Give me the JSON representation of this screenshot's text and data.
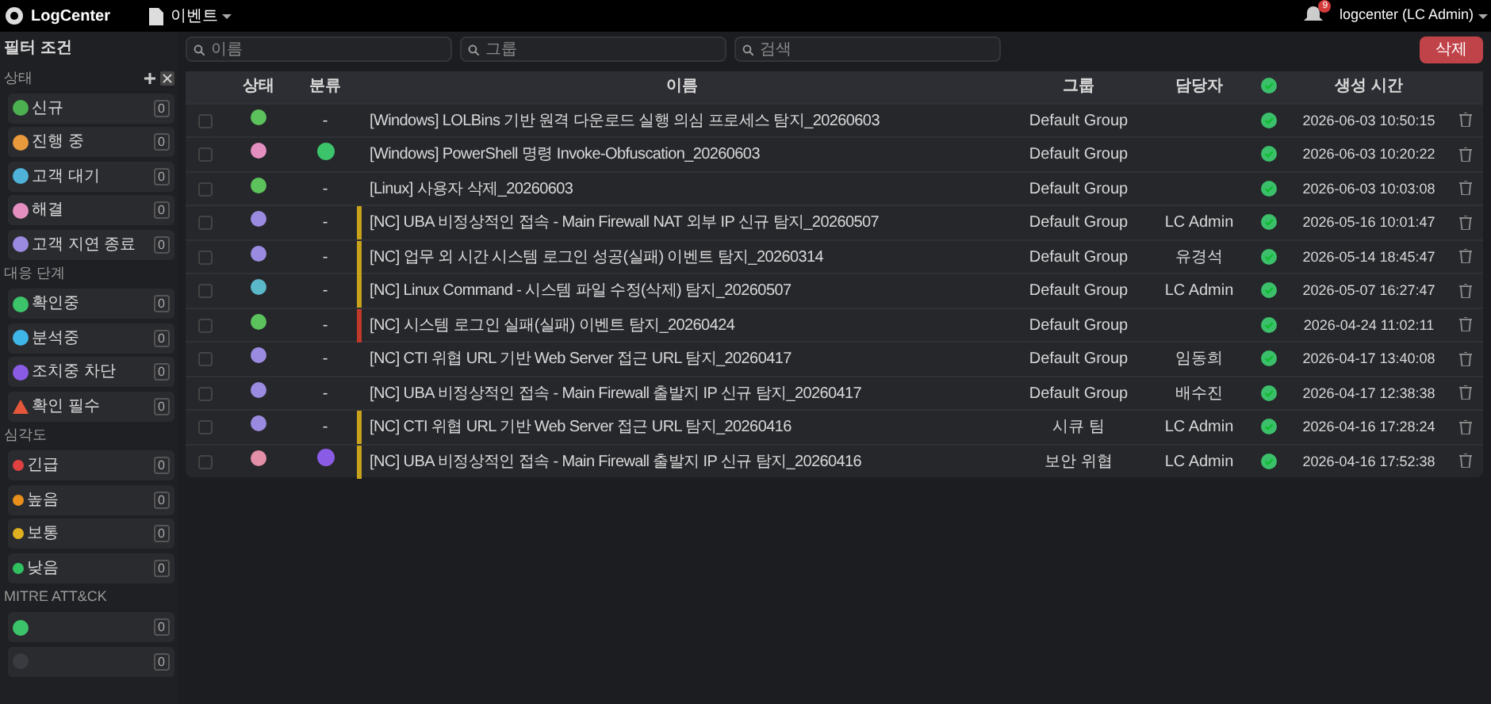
{
  "topbar": {
    "logo": "LogCenter",
    "workspace": "이벤트",
    "notifications": "9",
    "user": "logcenter (LC Admin)"
  },
  "sidebar": {
    "title": "필터 조건",
    "sections": [
      {
        "title": "상태",
        "actions": true,
        "items": [
          {
            "label": "신규",
            "count": "0",
            "color": "#4caf50",
            "kind": "ball"
          },
          {
            "label": "진행 중",
            "count": "0",
            "color": "#e89a3c",
            "kind": "ball"
          },
          {
            "label": "고객 대기",
            "count": "0",
            "color": "#4fb3d9",
            "kind": "ball"
          },
          {
            "label": "해결",
            "count": "0",
            "color": "#e48fc0",
            "kind": "ball"
          },
          {
            "label": "고객 지연 종료",
            "count": "0",
            "color": "#9b8be0",
            "kind": "ball"
          }
        ]
      },
      {
        "title": "대응 단계",
        "items": [
          {
            "label": "확인중",
            "count": "0",
            "color": "#3cc46a",
            "kind": "ball"
          },
          {
            "label": "분석중",
            "count": "0",
            "color": "#3fb6e8",
            "kind": "ball"
          },
          {
            "label": "조치중 차단",
            "count": "0",
            "color": "#8a5ce6",
            "kind": "ball"
          },
          {
            "label": "확인 필수",
            "count": "0",
            "color": "#e5573a",
            "kind": "warning"
          }
        ]
      },
      {
        "title": "심각도",
        "items": [
          {
            "label": "긴급",
            "count": "0",
            "color": "#e04040",
            "kind": "dot"
          },
          {
            "label": "높음",
            "count": "0",
            "color": "#e8901c",
            "kind": "dot"
          },
          {
            "label": "보통",
            "count": "0",
            "color": "#e0b020",
            "kind": "dot"
          },
          {
            "label": "낮음",
            "count": "0",
            "color": "#30c060",
            "kind": "dot"
          }
        ]
      },
      {
        "title": "MITRE ATT&CK",
        "items": [
          {
            "count": "0",
            "color": "#3cc46a",
            "kind": "ball"
          },
          {
            "count": "0",
            "color": "#3a3b40",
            "kind": "ball"
          }
        ]
      }
    ]
  },
  "filters": [
    {
      "placeholder": "이름"
    },
    {
      "placeholder": "그룹"
    },
    {
      "placeholder": "검색"
    }
  ],
  "delete_button": "삭제",
  "table": {
    "columns": [
      "상태",
      "분류",
      "이름",
      "그룹",
      "담당자",
      "생성 시간"
    ],
    "rows": [
      {
        "status": {
          "color": "#5cc25c"
        },
        "category": {
          "kind": "dash",
          "text": "-"
        },
        "name": "[Windows] LOLBins 기반 원격 다운로드 실행 의심 프로세스 탐지_20260603",
        "group": "Default Group",
        "assignee": "",
        "checked": true,
        "created": "2026-06-03 10:50:15",
        "selected": false
      },
      {
        "status": {
          "color": "#e48fc0"
        },
        "category": {
          "kind": "dot",
          "color": "#3cc46a"
        },
        "name": "[Windows] PowerShell 명령 Invoke-Obfuscation_20260603",
        "group": "Default Group",
        "assignee": "",
        "checked": true,
        "created": "2026-06-03 10:20:22",
        "selected": false
      },
      {
        "status": {
          "color": "#5cc25c"
        },
        "category": {
          "kind": "dash",
          "text": "-"
        },
        "name": "[Linux] 사용자 삭제_20260603",
        "group": "Default Group",
        "assignee": "",
        "checked": true,
        "created": "2026-06-03 10:03:08",
        "selected": false
      },
      {
        "severity": {
          "color": "#c9a21c"
        },
        "status": {
          "color": "#9b8be0"
        },
        "category": {
          "kind": "dash",
          "text": "-"
        },
        "name": "[NC] UBA 비정상적인 접속 - Main Firewall NAT 외부 IP 신규 탐지_20260507",
        "group": "Default Group",
        "assignee": "LC Admin",
        "checked": true,
        "created": "2026-05-16 10:01:47",
        "selected": false
      },
      {
        "severity": {
          "color": "#c9a21c"
        },
        "status": {
          "color": "#9b8be0"
        },
        "category": {
          "kind": "dash",
          "text": "-"
        },
        "name": "[NC] 업무 외 시간 시스템 로그인 성공(실패) 이벤트 탐지_20260314",
        "group": "Default Group",
        "assignee": "유경석",
        "checked": true,
        "created": "2026-05-14 18:45:47",
        "selected": false
      },
      {
        "severity": {
          "color": "#c9a21c"
        },
        "status": {
          "color": "#5ab8c8"
        },
        "category": {
          "kind": "dash",
          "text": "-"
        },
        "name": "[NC] Linux Command - 시스템 파일 수정(삭제) 탐지_20260507",
        "group": "Default Group",
        "assignee": "LC Admin",
        "checked": true,
        "created": "2026-05-07 16:27:47",
        "selected": false
      },
      {
        "severity": {
          "color": "#c0392b"
        },
        "status": {
          "color": "#5cc25c"
        },
        "category": {
          "kind": "dash",
          "text": "-"
        },
        "name": "[NC] 시스템 로그인 실패(실패) 이벤트 탐지_20260424",
        "group": "Default Group",
        "assignee": "",
        "checked": true,
        "created": "2026-04-24 11:02:11",
        "selected": false
      },
      {
        "status": {
          "color": "#9b8be0"
        },
        "category": {
          "kind": "dash",
          "text": "-"
        },
        "name": "[NC] CTI 위협 URL 기반 Web Server 접근 URL 탐지_20260417",
        "group": "Default Group",
        "assignee": "임동희",
        "checked": true,
        "created": "2026-04-17 13:40:08",
        "selected": false
      },
      {
        "status": {
          "color": "#9b8be0"
        },
        "category": {
          "kind": "dash",
          "text": "-"
        },
        "name": "[NC] UBA 비정상적인 접속 - Main Firewall 출발지 IP 신규 탐지_20260417",
        "group": "Default Group",
        "assignee": "배수진",
        "checked": true,
        "created": "2026-04-17 12:38:38",
        "selected": false
      },
      {
        "severity": {
          "color": "#c9a21c"
        },
        "status": {
          "color": "#9b8be0"
        },
        "category": {
          "kind": "dash",
          "text": "-"
        },
        "name": "[NC] CTI 위협 URL 기반 Web Server 접근 URL 탐지_20260416",
        "group": "시큐 팀",
        "assignee": "LC Admin",
        "checked": true,
        "created": "2026-04-16 17:28:24",
        "selected": false
      },
      {
        "severity": {
          "color": "#c9a21c"
        },
        "status": {
          "color": "#e48fa8"
        },
        "category": {
          "kind": "dot",
          "color": "#8a5ce6"
        },
        "name": "[NC] UBA 비정상적인 접속 - Main Firewall 출발지 IP 신규 탐지_20260416",
        "group": "보안 위협",
        "assignee": "LC Admin",
        "checked": true,
        "created": "2026-04-16 17:52:38",
        "selected": false
      }
    ]
  }
}
